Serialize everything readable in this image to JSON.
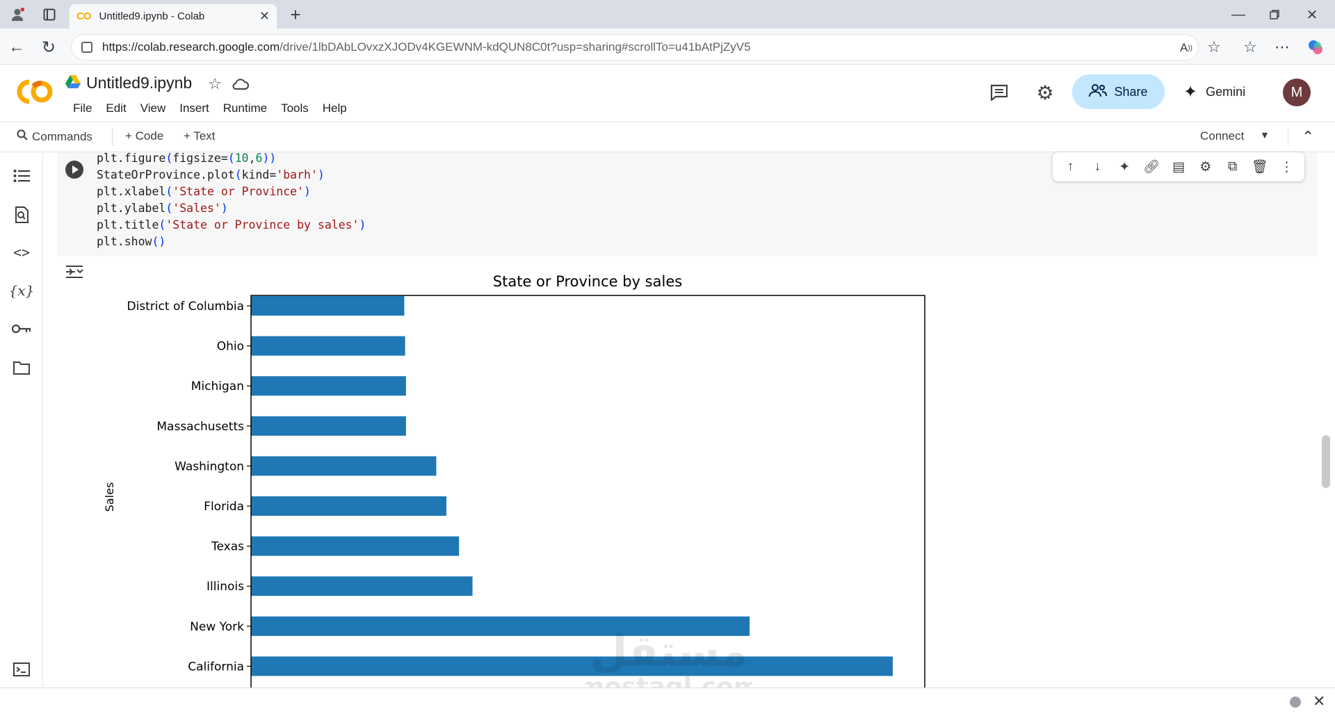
{
  "browser": {
    "tab_title": "Untitled9.ipynb - Colab",
    "tab_favicon": "CO",
    "url_domain": "https://colab.research.google.com",
    "url_path": "/drive/1lbDAbLOvxzXJODv4KGEWNM-kdQUN8C0t?usp=sharing#scrollTo=u41bAtPjZyV5"
  },
  "notebook": {
    "title": "Untitled9.ipynb",
    "menu": [
      "File",
      "Edit",
      "View",
      "Insert",
      "Runtime",
      "Tools",
      "Help"
    ],
    "share_label": "Share",
    "gemini_label": "Gemini",
    "avatar_initial": "M"
  },
  "toolbar": {
    "commands_label": "Commands",
    "code_label": "+ Code",
    "text_label": "+ Text",
    "connect_label": "Connect"
  },
  "code_lines": [
    "plt.figure(figsize=(10,6))",
    "StateOrProvince.plot(kind='barh')",
    "plt.xlabel('State or Province')",
    "plt.ylabel('Sales')",
    "plt.title('State or Province by sales')",
    "plt.show()"
  ],
  "chart_data": {
    "type": "bar",
    "orientation": "horizontal",
    "title": "State or Province by sales",
    "xlabel": "",
    "ylabel": "Sales",
    "categories": [
      "District of Columbia",
      "Ohio",
      "Michigan",
      "Massachusetts",
      "Washington",
      "Florida",
      "Texas",
      "Illinois",
      "New York",
      "California"
    ],
    "values": [
      18.2,
      18.3,
      18.4,
      18.4,
      22.0,
      23.2,
      24.7,
      26.3,
      59.2,
      76.2
    ],
    "xlim": [
      0,
      80
    ],
    "bar_color": "#1f77b4",
    "grid": false
  },
  "watermark": {
    "arabic": "مستقل",
    "latin": "mostaql.com"
  }
}
